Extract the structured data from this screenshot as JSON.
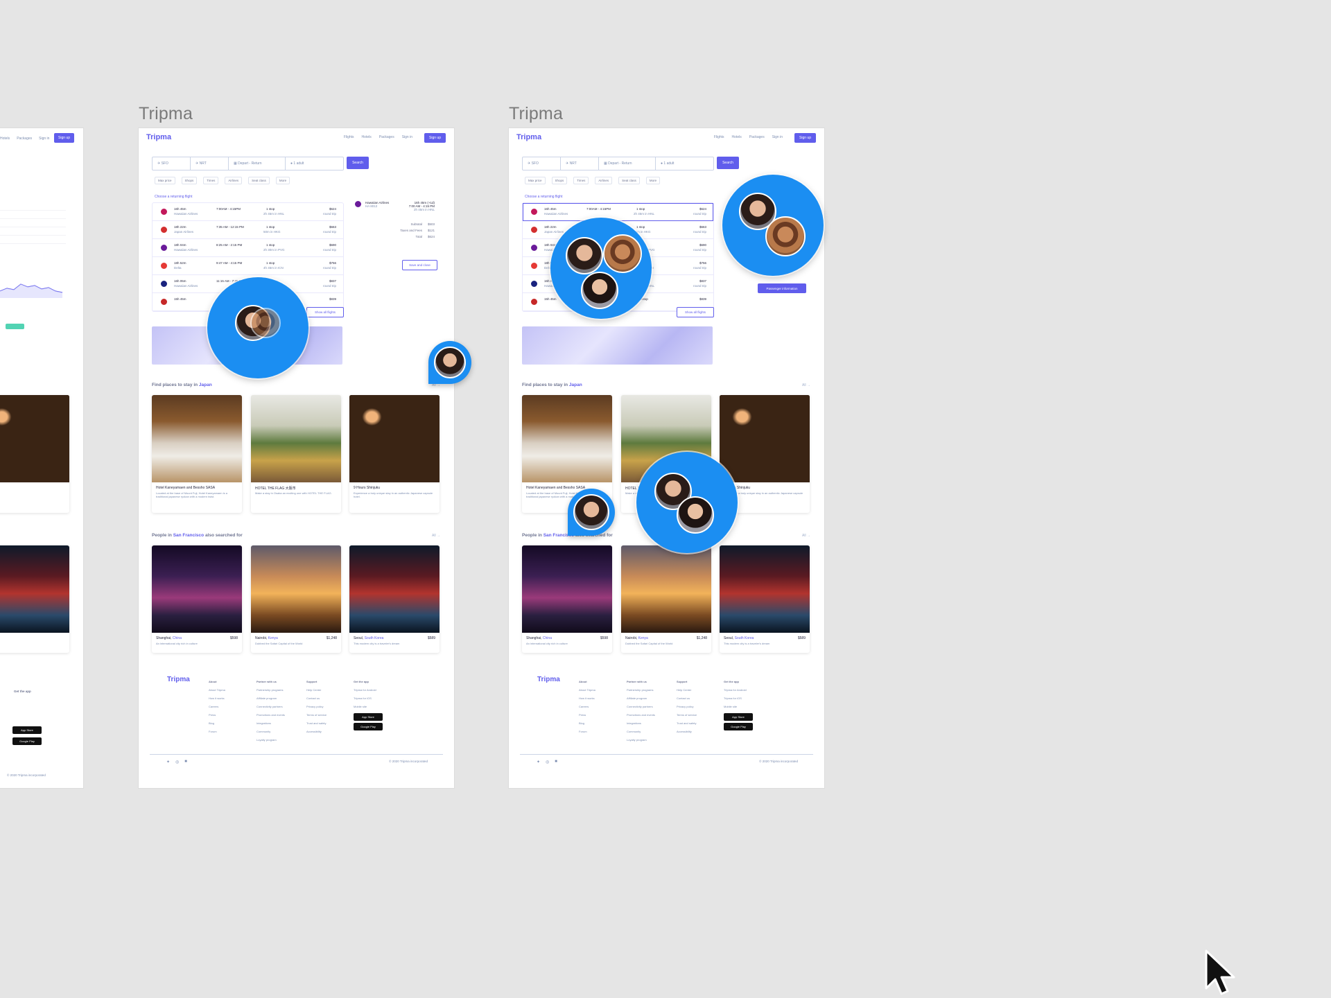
{
  "frames": [
    {
      "title": "Tripma"
    },
    {
      "title": "Tripma"
    }
  ],
  "app": {
    "logo": "Tripma",
    "nav": [
      "Flights",
      "Hotels",
      "Packages",
      "Sign in"
    ],
    "signup": "Sign up"
  },
  "search": {
    "from": "SFO",
    "to": "NRT",
    "dates": "Depart - Return",
    "adults": "1 adult",
    "button": "Search"
  },
  "filters": [
    "Max price",
    "Shops",
    "Times",
    "Airlines",
    "Seat class",
    "More"
  ],
  "flights_label": "Choose a returning flight",
  "flights": [
    {
      "duration": "16h 45m",
      "airline": "Hawaiian Airlines",
      "time": "7:00AM - 4:15PM",
      "stops": "1 stop",
      "stop_detail": "2h 45m in HNL",
      "price": "$624",
      "trip": "round trip",
      "color": "#c2185b"
    },
    {
      "duration": "18h 22m",
      "airline": "Japan Airlines",
      "time": "7:35 AM - 12:15 PM",
      "stops": "1 stop",
      "stop_detail": "50m in HKG",
      "price": "$663",
      "trip": "round trip",
      "color": "#d32f2f"
    },
    {
      "duration": "18h 04m",
      "airline": "Hawaiian Airlines",
      "time": "8:25 AM - 2:15 PM",
      "stops": "1 stop",
      "stop_detail": "2h 30m in PVG",
      "price": "$690",
      "trip": "round trip",
      "color": "#6a1b9a"
    },
    {
      "duration": "18h 52m",
      "airline": "Delta",
      "time": "9:47 AM - 4:15 PM",
      "stops": "1 stop",
      "stop_detail": "4h 45m in ICN",
      "price": "$756",
      "trip": "round trip",
      "color": "#e53935"
    },
    {
      "duration": "16h 05m",
      "airline": "Hawaiian Airlines",
      "time": "11:15 AM - 7:45 PM",
      "stops": "1 stop",
      "stop_detail": "2h 45m in HNL",
      "price": "$837",
      "trip": "round trip",
      "color": "#1a237e"
    },
    {
      "duration": "15h 45m",
      "airline": "",
      "time": "",
      "stops": "Nonstop",
      "stop_detail": "",
      "price": "$839",
      "trip": "",
      "color": "#c62828"
    }
  ],
  "show_all": "Show all flights",
  "summary": {
    "airline": "Hawaiian Airlines",
    "code": "HA 8012",
    "duration": "16h 45m (+1d)",
    "times": "7:00 AM - 4:15 PM",
    "layover": "2h 45m in HNL",
    "subtotal_label": "Subtotal",
    "subtotal": "$503",
    "taxes_label": "Taxes and Fees",
    "taxes": "$121",
    "total_label": "Total",
    "total": "$624",
    "save_button": "Save and close",
    "passenger_button": "Passenger information"
  },
  "stays": {
    "heading_prefix": "Find places to stay in ",
    "heading_highlight": "Japan",
    "all": "All →",
    "cards": [
      {
        "title": "Hotel Kaneyamaen and Bessho SASA",
        "desc": "Located at the base of Mount Fuji, Hotel Kaneyamaen is a traditional japanese ryokan with a modern twist."
      },
      {
        "title": "HOTEL THE FLAG 大阪市",
        "desc": "Make a stay in Osaka an exciting one with HOTEL THE FLAG."
      },
      {
        "title": "9 Hours Shinjuku",
        "desc": "Experience a truly unique stay in an authentic Japanese capsule hotel."
      }
    ]
  },
  "people": {
    "heading_prefix": "People in ",
    "heading_highlight": "San Francisco",
    "heading_suffix": " also searched for",
    "all": "All →",
    "cards": [
      {
        "city": "Shanghai,",
        "country": " China",
        "price": "$598",
        "desc": "An international city rich in culture"
      },
      {
        "city": "Nairobi,",
        "country": " Kenya",
        "price": "$1,248",
        "desc": "Dubbed the Safari Capital of the World"
      },
      {
        "city": "Seoul,",
        "country": " South Korea",
        "price": "$589",
        "desc": "This modern city is a traveler's dream"
      }
    ]
  },
  "footer": {
    "logo": "Tripma",
    "cols": [
      {
        "head": "About",
        "items": [
          "About Tripma",
          "How it works",
          "Careers",
          "Press",
          "Blog",
          "Forum"
        ]
      },
      {
        "head": "Partner with us",
        "items": [
          "Partnership programs",
          "Affiliate program",
          "Connectivity partners",
          "Promotions and events",
          "Integrations",
          "Community",
          "Loyalty program"
        ]
      },
      {
        "head": "Support",
        "items": [
          "Help Center",
          "Contact us",
          "Privacy policy",
          "Terms of service",
          "Trust and safety",
          "Accessibility"
        ]
      },
      {
        "head": "Get the app",
        "items": [
          "Tripma for Android",
          "Tripma for iOS",
          "Mobile site"
        ]
      }
    ],
    "app_store": "App Store",
    "google_play": "Google Play",
    "copyright": "© 2020 Tripma incorporated"
  },
  "colors": {
    "brand": "#605dec",
    "avatar_bubble": "#1b8ef2",
    "canvas": "#e5e5e5"
  }
}
